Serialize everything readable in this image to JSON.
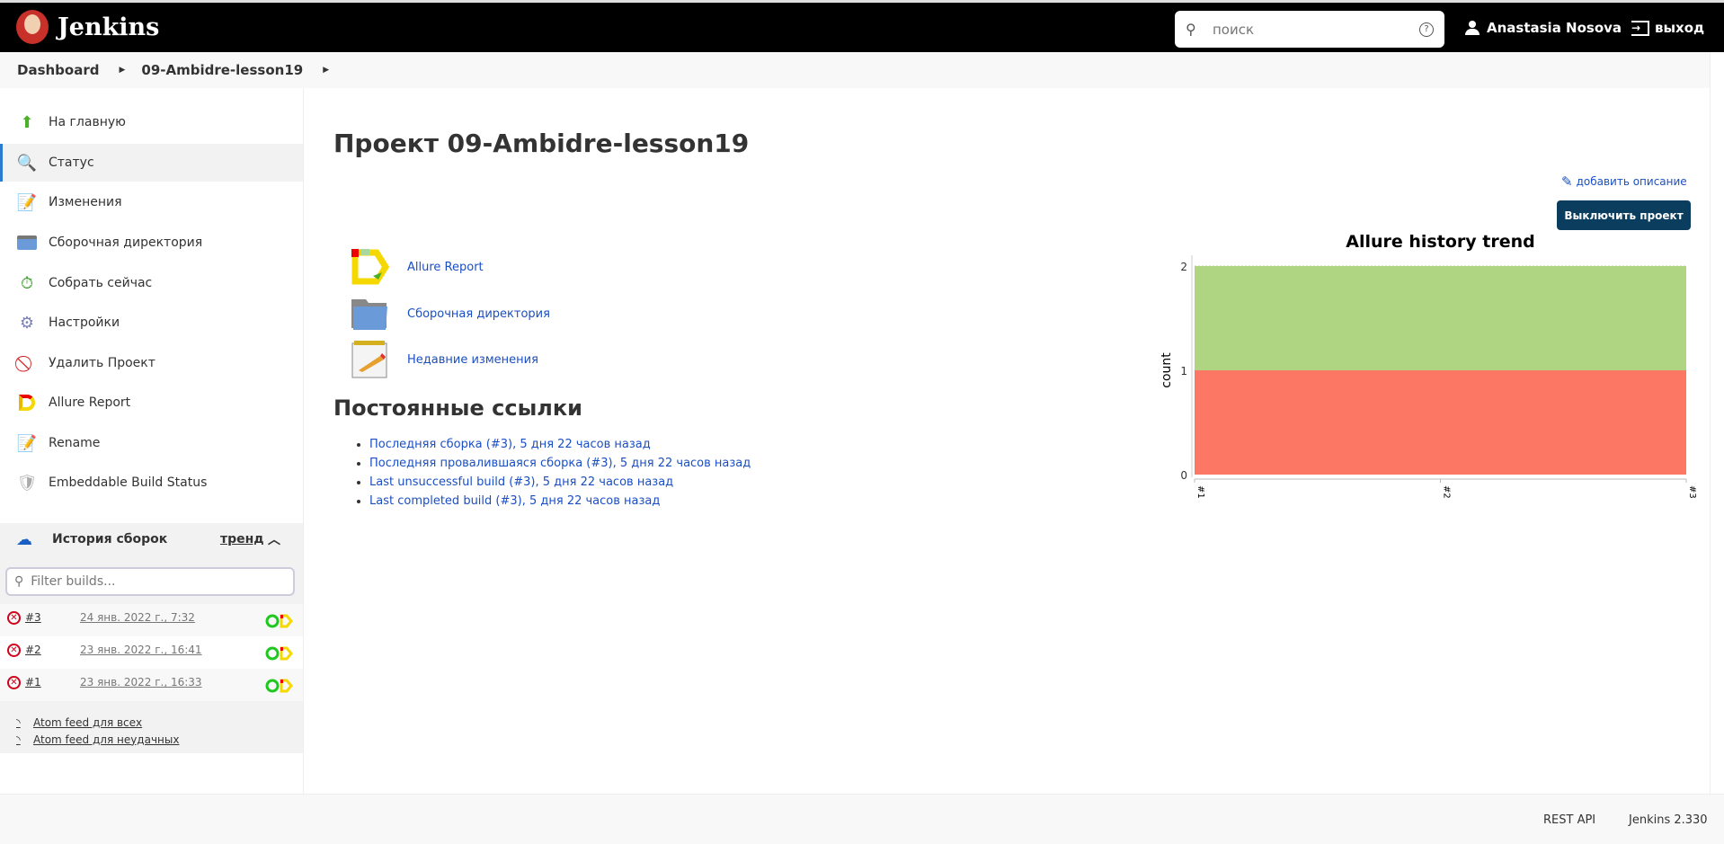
{
  "header": {
    "app_name": "Jenkins",
    "search_placeholder": "поиск",
    "user": "Anastasia Nosova",
    "logout": "выход"
  },
  "breadcrumb": [
    "Dashboard",
    "09-Ambidre-lesson19"
  ],
  "sidebar": {
    "items": [
      {
        "label": "На главную",
        "icon": "arrow-up-icon"
      },
      {
        "label": "Статус",
        "icon": "magnifier-icon",
        "active": true
      },
      {
        "label": "Изменения",
        "icon": "notepad-icon"
      },
      {
        "label": "Сборочная директория",
        "icon": "folder-icon"
      },
      {
        "label": "Собрать сейчас",
        "icon": "clock-play-icon"
      },
      {
        "label": "Настройки",
        "icon": "gear-icon"
      },
      {
        "label": "Удалить Проект",
        "icon": "no-entry-icon"
      },
      {
        "label": "Allure Report",
        "icon": "allure-icon"
      },
      {
        "label": "Rename",
        "icon": "notepad-icon"
      },
      {
        "label": "Embeddable Build Status",
        "icon": "shield-icon"
      }
    ]
  },
  "history": {
    "title": "История сборок",
    "trend": "тренд",
    "filter_placeholder": "Filter builds...",
    "builds": [
      {
        "number": "#3",
        "date": "24 янв. 2022 г., 7:32",
        "status": "failed"
      },
      {
        "number": "#2",
        "date": "23 янв. 2022 г., 16:41",
        "status": "failed"
      },
      {
        "number": "#1",
        "date": "23 янв. 2022 г., 16:33",
        "status": "failed"
      }
    ],
    "feeds": [
      "Atom feed для всех",
      "Atom feed для неудачных"
    ]
  },
  "main": {
    "title": "Проект 09-Ambidre-lesson19",
    "add_description": "добавить описание",
    "disable_button": "Выключить проект",
    "icon_links": [
      {
        "label": "Allure Report",
        "icon": "allure-icon"
      },
      {
        "label": "Сборочная директория",
        "icon": "folder-icon"
      },
      {
        "label": "Недавние изменения",
        "icon": "notepad-icon"
      }
    ],
    "permalinks_title": "Постоянные ссылки",
    "permalinks": [
      "Последняя сборка (#3), 5 дня 22 часов назад",
      "Последняя провалившаяся сборка (#3), 5 дня 22 часов назад",
      "Last unsuccessful build (#3), 5 дня 22 часов назад",
      "Last completed build (#3), 5 дня 22 часов назад"
    ]
  },
  "chart_data": {
    "type": "area",
    "title": "Allure history trend",
    "xlabel": "",
    "ylabel": "count",
    "categories": [
      "#1",
      "#2",
      "#3"
    ],
    "ylim": [
      0,
      2
    ],
    "yticks": [
      "0",
      "1",
      "2"
    ],
    "stacked": true,
    "series": [
      {
        "values": [
          1,
          1,
          1
        ],
        "color": "#fd7864"
      },
      {
        "values": [
          1,
          1,
          1
        ],
        "color": "#afd582"
      }
    ]
  },
  "footer": {
    "rest_api": "REST API",
    "version": "Jenkins 2.330"
  }
}
